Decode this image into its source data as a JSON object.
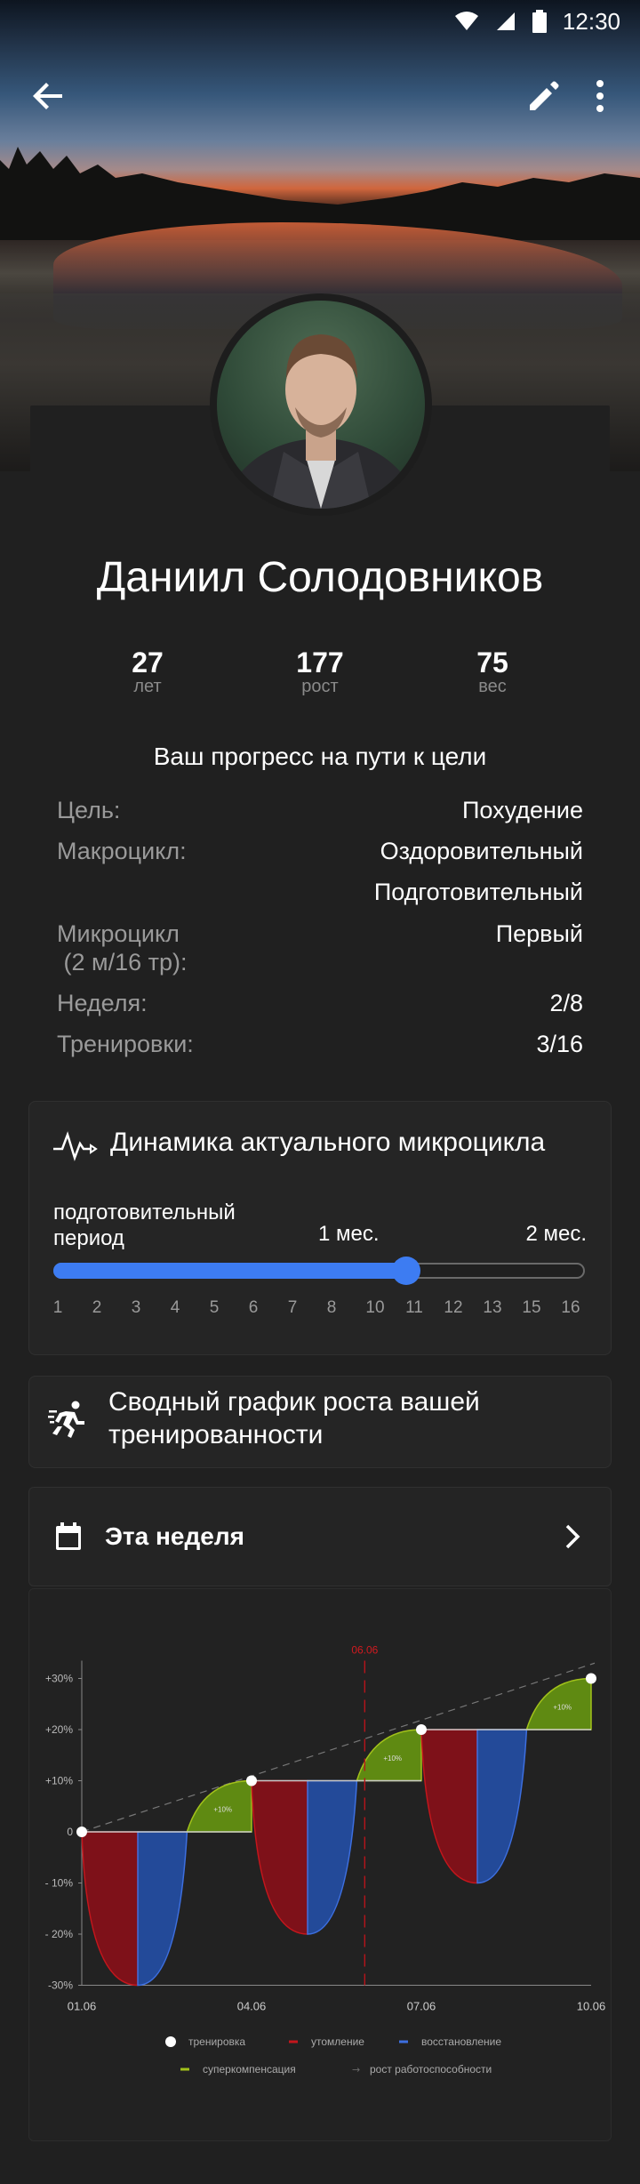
{
  "status_bar": {
    "time": "12:30",
    "icons": [
      "wifi-icon",
      "signal-icon",
      "battery-icon"
    ]
  },
  "toolbar": {
    "back_icon": "arrow-back-icon",
    "edit_icon": "pencil-icon",
    "more_icon": "more-vert-icon"
  },
  "profile": {
    "name": "Даниил Солодовников",
    "stats": [
      {
        "value": "27",
        "label": "лет"
      },
      {
        "value": "177",
        "label": "рост"
      },
      {
        "value": "75",
        "label": "вес"
      }
    ]
  },
  "progress": {
    "title": "Ваш прогресс на пути к цели",
    "rows": [
      {
        "key": "Цель:",
        "value": "Похудение"
      },
      {
        "key": "Макроцикл:",
        "value": "Оздоровительный\nПодготовительный"
      },
      {
        "key": "Микроцикл\n (2 м/16 тр):",
        "value": "Первый"
      },
      {
        "key": "Неделя:",
        "value": "2/8"
      },
      {
        "key": "Тренировки:",
        "value": "3/16"
      }
    ]
  },
  "dynamics": {
    "icon": "pulse-icon",
    "title": "Динамика актуального  микроцикла",
    "period_label": "подготовительный\nпериод",
    "month1": "1 мес.",
    "month2": "2 мес.",
    "progress_fraction": 0.66,
    "ticks": [
      "1",
      "2",
      "3",
      "4",
      "5",
      "6",
      "7",
      "8",
      "10",
      "11",
      "12",
      "13",
      "15",
      "16"
    ],
    "accent": "#3d7cf2"
  },
  "summary": {
    "icon": "running-icon",
    "title": "Сводный график роста вашей\nтренированности"
  },
  "week": {
    "icon": "calendar-icon",
    "label": "Эта неделя",
    "chevron": "chevron-right-icon"
  },
  "chart_data": {
    "type": "area",
    "x_ticks": [
      "01.06",
      "04.06",
      "07.06",
      "10.06"
    ],
    "y_ticks": [
      "+30%",
      "+20%",
      "+10%",
      "0",
      "- 10%",
      "- 20%",
      "-30%"
    ],
    "ylim": [
      -30,
      30
    ],
    "marker_label": "06.06",
    "points": [
      {
        "x": "01.06",
        "y": 0
      },
      {
        "x": "04.06",
        "y": 10
      },
      {
        "x": "07.06",
        "y": 20
      },
      {
        "x": "10.06",
        "y": 30
      }
    ],
    "supercompensation_labels": [
      "+10%",
      "+10%",
      "+10%"
    ],
    "legend": [
      {
        "name": "тренировка",
        "color": "#ffffff"
      },
      {
        "name": "утомление",
        "color": "#c4161c"
      },
      {
        "name": "восстановление",
        "color": "#3d6fe0"
      },
      {
        "name": "суперкомпенсация",
        "color": "#a2c21a"
      },
      {
        "name": "рост работоспособности",
        "color": "#6a6a6a"
      }
    ],
    "colors": {
      "fatigue": "#7e1119",
      "recovery": "#234a99",
      "supercomp": "#5f8a12",
      "line": "#c9c9c9"
    }
  }
}
